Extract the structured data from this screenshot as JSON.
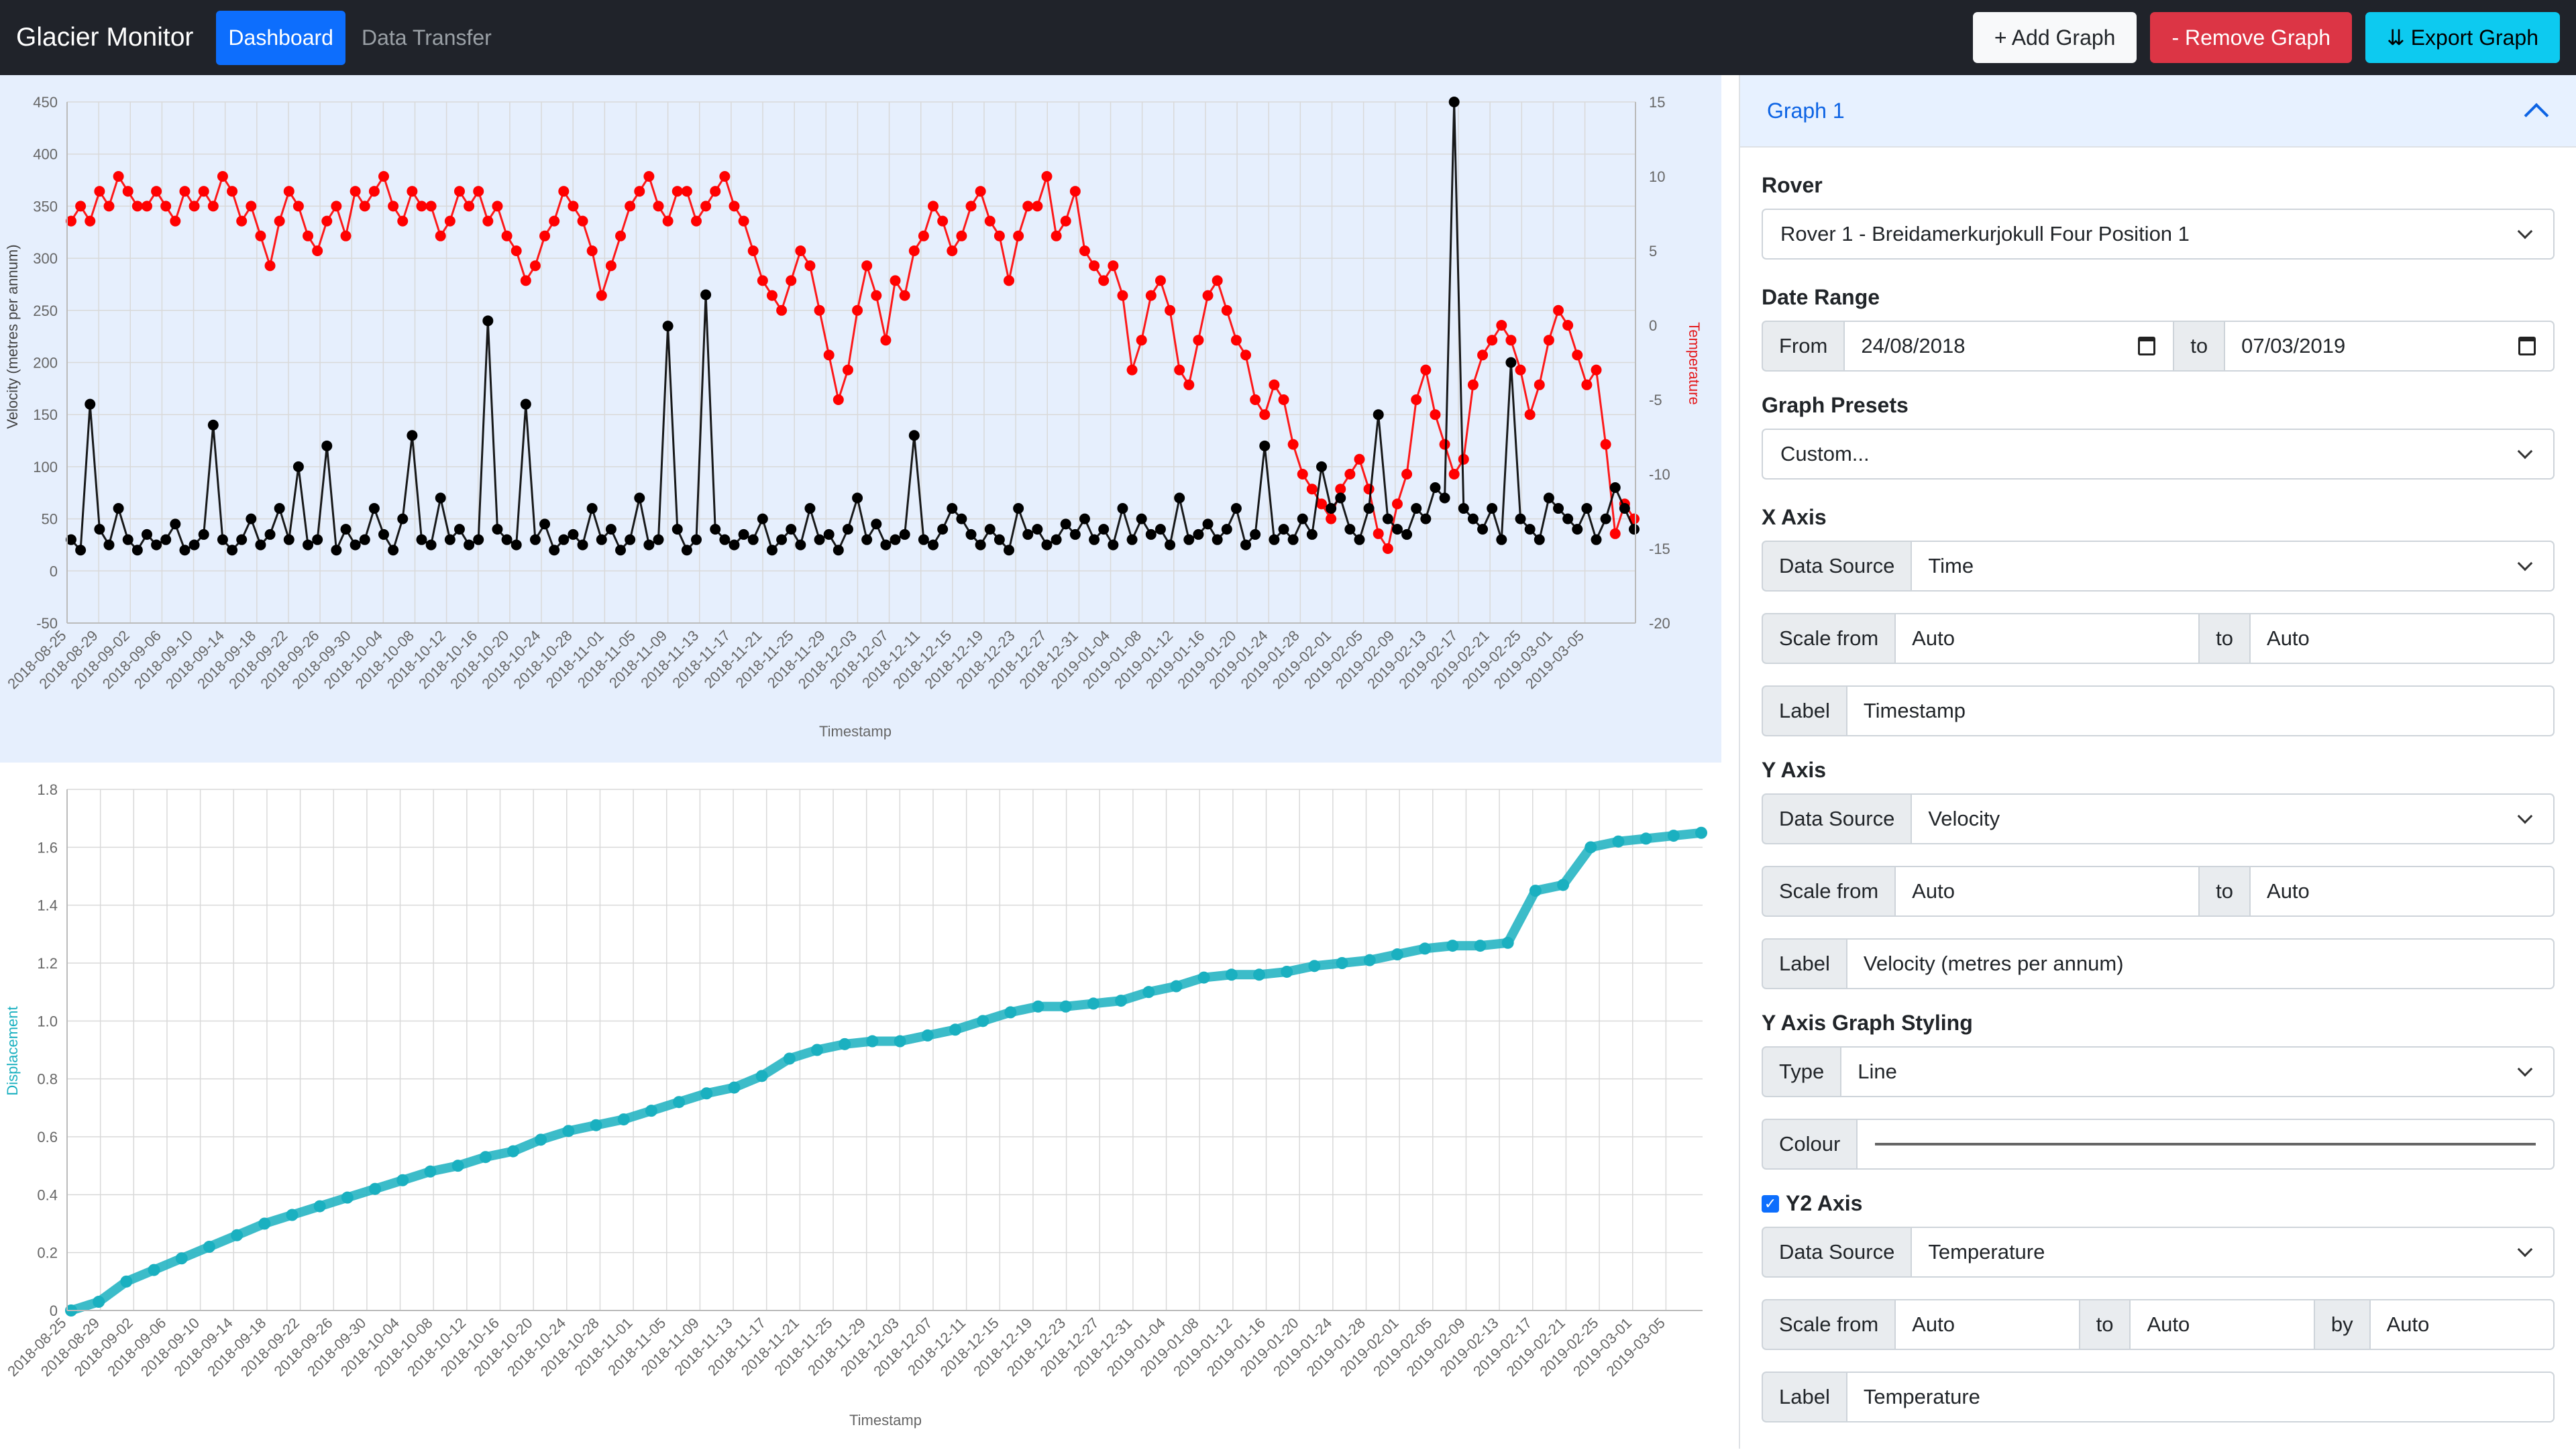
{
  "navbar": {
    "brand": "Glacier Monitor",
    "links": [
      "Dashboard",
      "Data Transfer"
    ],
    "add_graph": "+ Add Graph",
    "remove_graph": "- Remove Graph",
    "export_graph": "⇊ Export Graph"
  },
  "panel": {
    "title": "Graph 1",
    "rover_label": "Rover",
    "rover_value": "Rover 1 - Breidamerkurjokull Four Position 1",
    "date_range_label": "Date Range",
    "from_label": "From",
    "from_value": "24/08/2018",
    "to_label": "to",
    "to_value": "07/03/2019",
    "presets_label": "Graph Presets",
    "presets_value": "Custom...",
    "x_axis": {
      "label": "X Axis",
      "data_source_label": "Data Source",
      "data_source": "Time",
      "scale_from_label": "Scale from",
      "scale_from": "Auto",
      "to_label": "to",
      "scale_to": "Auto",
      "label_label": "Label",
      "label_value": "Timestamp"
    },
    "y_axis": {
      "label": "Y Axis",
      "data_source_label": "Data Source",
      "data_source": "Velocity",
      "scale_from_label": "Scale from",
      "scale_from": "Auto",
      "to_label": "to",
      "scale_to": "Auto",
      "label_label": "Label",
      "label_value": "Velocity (metres per annum)"
    },
    "styling": {
      "label": "Y Axis Graph Styling",
      "type_label": "Type",
      "type_value": "Line",
      "colour_label": "Colour",
      "colour_value": "#000000"
    },
    "y2_axis": {
      "label": "Y2 Axis",
      "checked": true,
      "data_source_label": "Data Source",
      "data_source": "Temperature",
      "scale_from_label": "Scale from",
      "scale_from": "Auto",
      "to_label": "to",
      "scale_to": "Auto",
      "by_label": "by",
      "by_value": "Auto",
      "label_label": "Label",
      "label_value": "Temperature"
    }
  },
  "chart_data": [
    {
      "type": "line",
      "x_label": "Timestamp",
      "y_label": "Velocity (metres per annum)",
      "y2_label": "Temperature",
      "ylim": [
        -50,
        450
      ],
      "y2lim": [
        -20,
        15
      ],
      "y_ticks": [
        450,
        400,
        350,
        300,
        250,
        200,
        150,
        100,
        50,
        0,
        -50
      ],
      "y2_ticks": [
        15,
        10,
        5,
        0,
        -5,
        -10,
        -15,
        -20
      ],
      "x_ticks": [
        "2018-08-25",
        "2018-08-29",
        "2018-09-02",
        "2018-09-06",
        "2018-09-10",
        "2018-09-14",
        "2018-09-18",
        "2018-09-22",
        "2018-09-26",
        "2018-09-30",
        "2018-10-04",
        "2018-10-08",
        "2018-10-12",
        "2018-10-16",
        "2018-10-20",
        "2018-10-24",
        "2018-10-28",
        "2018-11-01",
        "2018-11-05",
        "2018-11-09",
        "2018-11-13",
        "2018-11-17",
        "2018-11-21",
        "2018-11-25",
        "2018-11-29",
        "2018-12-03",
        "2018-12-07",
        "2018-12-11",
        "2018-12-15",
        "2018-12-19",
        "2018-12-23",
        "2018-12-27",
        "2018-12-31",
        "2019-01-04",
        "2019-01-08",
        "2019-01-12",
        "2019-01-16",
        "2019-01-20",
        "2019-01-24",
        "2019-01-28",
        "2019-02-01",
        "2019-02-05",
        "2019-02-09",
        "2019-02-13",
        "2019-02-17",
        "2019-02-21",
        "2019-02-25",
        "2019-03-01",
        "2019-03-05"
      ],
      "grid": true,
      "series": [
        {
          "axis": "y2",
          "color": "#ff0000",
          "values": [
            7,
            8,
            7,
            9,
            8,
            10,
            9,
            8,
            8,
            9,
            8,
            7,
            9,
            8,
            9,
            8,
            10,
            9,
            7,
            8,
            6,
            4,
            7,
            9,
            8,
            6,
            5,
            7,
            8,
            6,
            9,
            8,
            9,
            10,
            8,
            7,
            9,
            8,
            8,
            6,
            7,
            9,
            8,
            9,
            7,
            8,
            6,
            5,
            3,
            4,
            6,
            7,
            9,
            8,
            7,
            5,
            2,
            4,
            6,
            8,
            9,
            10,
            8,
            7,
            9,
            9,
            7,
            8,
            9,
            10,
            8,
            7,
            5,
            3,
            2,
            1,
            3,
            5,
            4,
            1,
            -2,
            -5,
            -3,
            1,
            4,
            2,
            -1,
            3,
            2,
            5,
            6,
            8,
            7,
            5,
            6,
            8,
            9,
            7,
            6,
            3,
            6,
            8,
            8,
            10,
            6,
            7,
            9,
            5,
            4,
            3,
            4,
            2,
            -3,
            -1,
            2,
            3,
            1,
            -3,
            -4,
            -1,
            2,
            3,
            1,
            -1,
            -2,
            -5,
            -6,
            -4,
            -5,
            -8,
            -10,
            -11,
            -12,
            -13,
            -11,
            -10,
            -9,
            -11,
            -14,
            -15,
            -12,
            -10,
            -5,
            -3,
            -6,
            -8,
            -10,
            -9,
            -4,
            -2,
            -1,
            0,
            -1,
            -3,
            -6,
            -4,
            -1,
            1,
            0,
            -2,
            -4,
            -3,
            -8,
            -14,
            -12,
            -13
          ]
        },
        {
          "axis": "y",
          "color": "#000000",
          "values": [
            30,
            20,
            160,
            40,
            25,
            60,
            30,
            20,
            35,
            25,
            30,
            45,
            20,
            25,
            35,
            140,
            30,
            20,
            30,
            50,
            25,
            35,
            60,
            30,
            100,
            25,
            30,
            120,
            20,
            40,
            25,
            30,
            60,
            35,
            20,
            50,
            130,
            30,
            25,
            70,
            30,
            40,
            25,
            30,
            240,
            40,
            30,
            25,
            160,
            30,
            45,
            20,
            30,
            35,
            25,
            60,
            30,
            40,
            20,
            30,
            70,
            25,
            30,
            235,
            40,
            20,
            30,
            265,
            40,
            30,
            25,
            35,
            30,
            50,
            20,
            30,
            40,
            25,
            60,
            30,
            35,
            20,
            40,
            70,
            30,
            45,
            25,
            30,
            35,
            130,
            30,
            25,
            40,
            60,
            50,
            35,
            25,
            40,
            30,
            20,
            60,
            35,
            40,
            25,
            30,
            45,
            35,
            50,
            30,
            40,
            25,
            60,
            30,
            50,
            35,
            40,
            25,
            70,
            30,
            35,
            45,
            30,
            40,
            60,
            25,
            35,
            120,
            30,
            40,
            30,
            50,
            35,
            100,
            60,
            70,
            40,
            30,
            60,
            150,
            50,
            40,
            35,
            60,
            50,
            80,
            70,
            450,
            60,
            50,
            40,
            60,
            30,
            200,
            50,
            40,
            30,
            70,
            60,
            50,
            40,
            60,
            30,
            50,
            80,
            60,
            40
          ]
        }
      ]
    },
    {
      "type": "line",
      "x_label": "Timestamp",
      "y_label": "Displacement",
      "ylim": [
        0,
        1.8
      ],
      "y_ticks": [
        1.8,
        1.6,
        1.4,
        1.2,
        1.0,
        0.8,
        0.6,
        0.4,
        0.2,
        0
      ],
      "x_ticks": [
        "2018-08-25",
        "2018-08-29",
        "2018-09-02",
        "2018-09-06",
        "2018-09-10",
        "2018-09-14",
        "2018-09-18",
        "2018-09-22",
        "2018-09-26",
        "2018-09-30",
        "2018-10-04",
        "2018-10-08",
        "2018-10-12",
        "2018-10-16",
        "2018-10-20",
        "2018-10-24",
        "2018-10-28",
        "2018-11-01",
        "2018-11-05",
        "2018-11-09",
        "2018-11-13",
        "2018-11-17",
        "2018-11-21",
        "2018-11-25",
        "2018-11-29",
        "2018-12-03",
        "2018-12-07",
        "2018-12-11",
        "2018-12-15",
        "2018-12-19",
        "2018-12-23",
        "2018-12-27",
        "2018-12-31",
        "2019-01-04",
        "2019-01-08",
        "2019-01-12",
        "2019-01-16",
        "2019-01-20",
        "2019-01-24",
        "2019-01-28",
        "2019-02-01",
        "2019-02-05",
        "2019-02-09",
        "2019-02-13",
        "2019-02-17",
        "2019-02-21",
        "2019-02-25",
        "2019-03-01",
        "2019-03-05"
      ],
      "grid": true,
      "series": [
        {
          "color": "#1ab0c0",
          "values": [
            0.0,
            0.03,
            0.1,
            0.14,
            0.18,
            0.22,
            0.26,
            0.3,
            0.33,
            0.36,
            0.39,
            0.42,
            0.45,
            0.48,
            0.5,
            0.53,
            0.55,
            0.59,
            0.62,
            0.64,
            0.66,
            0.69,
            0.72,
            0.75,
            0.77,
            0.81,
            0.87,
            0.9,
            0.92,
            0.93,
            0.93,
            0.95,
            0.97,
            1.0,
            1.03,
            1.05,
            1.05,
            1.06,
            1.07,
            1.1,
            1.12,
            1.15,
            1.16,
            1.16,
            1.17,
            1.19,
            1.2,
            1.21,
            1.23,
            1.25,
            1.26,
            1.26,
            1.27,
            1.45,
            1.47,
            1.6,
            1.62,
            1.63,
            1.64,
            1.65
          ]
        }
      ]
    }
  ]
}
